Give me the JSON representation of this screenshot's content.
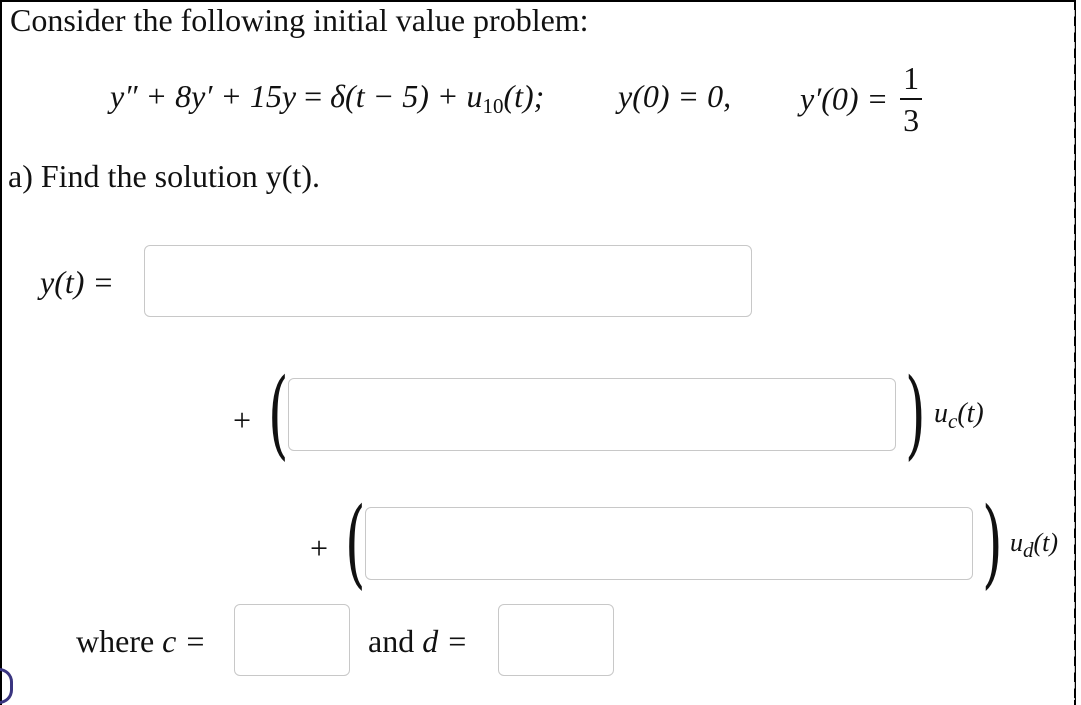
{
  "problem": {
    "intro": "Consider the following initial value problem:",
    "equation": {
      "lhs": "y″ + 8y′ + 15y",
      "equals": "=",
      "rhs_delta": "δ(t − 5) + ",
      "rhs_u": "u",
      "rhs_u_sub": "10",
      "rhs_tail": "(t);",
      "ic1": "y(0) = 0,",
      "ic2_lhs": "y′(0) =",
      "ic2_num": "1",
      "ic2_den": "3"
    },
    "part_a": "a) Find the solution y(t)."
  },
  "answer": {
    "y_label": "y(t) =",
    "y_value": "",
    "plus": "+",
    "uc_label": "u",
    "uc_sub": "c",
    "uc_tail": "(t)",
    "uc_value": "",
    "ud_label": "u",
    "ud_sub": "d",
    "ud_tail": "(t)",
    "ud_value": "",
    "where_label": "where",
    "c_label": "c =",
    "c_value": "",
    "and_label": "and",
    "d_label": "d =",
    "d_value": ""
  }
}
